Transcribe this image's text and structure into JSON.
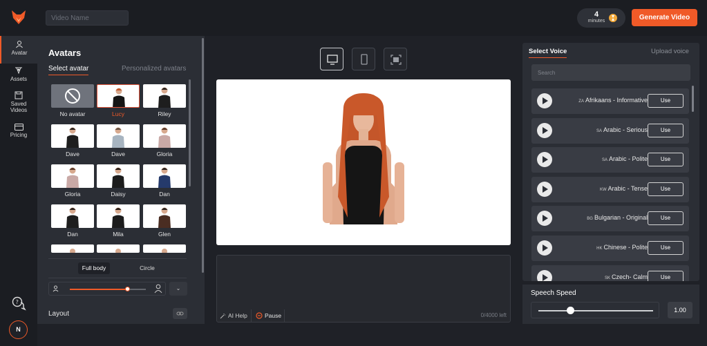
{
  "topbar": {
    "video_name_placeholder": "Video Name",
    "minutes_value": "4",
    "minutes_label": "minutes",
    "generate_label": "Generate Video"
  },
  "rail": {
    "items": [
      {
        "label": "Avatar",
        "icon": "user-icon",
        "active": true
      },
      {
        "label": "Assets",
        "icon": "assets-icon",
        "active": false
      },
      {
        "label": "Saved\nVideos",
        "icon": "save-icon",
        "active": false
      },
      {
        "label": "Pricing",
        "icon": "card-icon",
        "active": false
      }
    ],
    "user_initial": "N"
  },
  "avatars": {
    "title": "Avatars",
    "tab_select": "Select avatar",
    "tab_personalized": "Personalized avatars",
    "tiles": [
      {
        "name": "No avatar",
        "kind": "none"
      },
      {
        "name": "Lucy",
        "kind": "female-red",
        "selected": true
      },
      {
        "name": "Riley",
        "kind": "male"
      },
      {
        "name": "Dave",
        "kind": "male"
      },
      {
        "name": "Dave",
        "kind": "male-light"
      },
      {
        "name": "Gloria",
        "kind": "female"
      },
      {
        "name": "Gloria",
        "kind": "female"
      },
      {
        "name": "Daisy",
        "kind": "female-dark"
      },
      {
        "name": "Dan",
        "kind": "male-blue"
      },
      {
        "name": "Dan",
        "kind": "male"
      },
      {
        "name": "Mila",
        "kind": "female-dark"
      },
      {
        "name": "Glen",
        "kind": "male-brown"
      }
    ],
    "style_tabs": [
      "Full body",
      "Circle"
    ],
    "size_level": 0.75,
    "layout_label": "Layout"
  },
  "center": {
    "ai_help": "AI Help",
    "pause": "Pause",
    "char_count": "0/4000 left"
  },
  "voices": {
    "tab_select": "Select Voice",
    "tab_upload": "Upload voice",
    "search_placeholder": "Search",
    "use_label": "Use",
    "list": [
      {
        "code": "ZA",
        "name": "Afrikaans - Informative"
      },
      {
        "code": "SA",
        "name": "Arabic - Serious"
      },
      {
        "code": "SA",
        "name": "Arabic - Polite"
      },
      {
        "code": "KW",
        "name": "Arabic - Tense"
      },
      {
        "code": "BG",
        "name": "Bulgarian - Original"
      },
      {
        "code": "HK",
        "name": "Chinese - Polite"
      },
      {
        "code": "SK",
        "name": "Czech- Calm"
      }
    ]
  },
  "speech": {
    "label": "Speech Speed",
    "value": "1.00",
    "level": 0.5
  },
  "colors": {
    "accent": "#f05a28",
    "panel": "#2b2e35",
    "bg": "#1f2127"
  }
}
